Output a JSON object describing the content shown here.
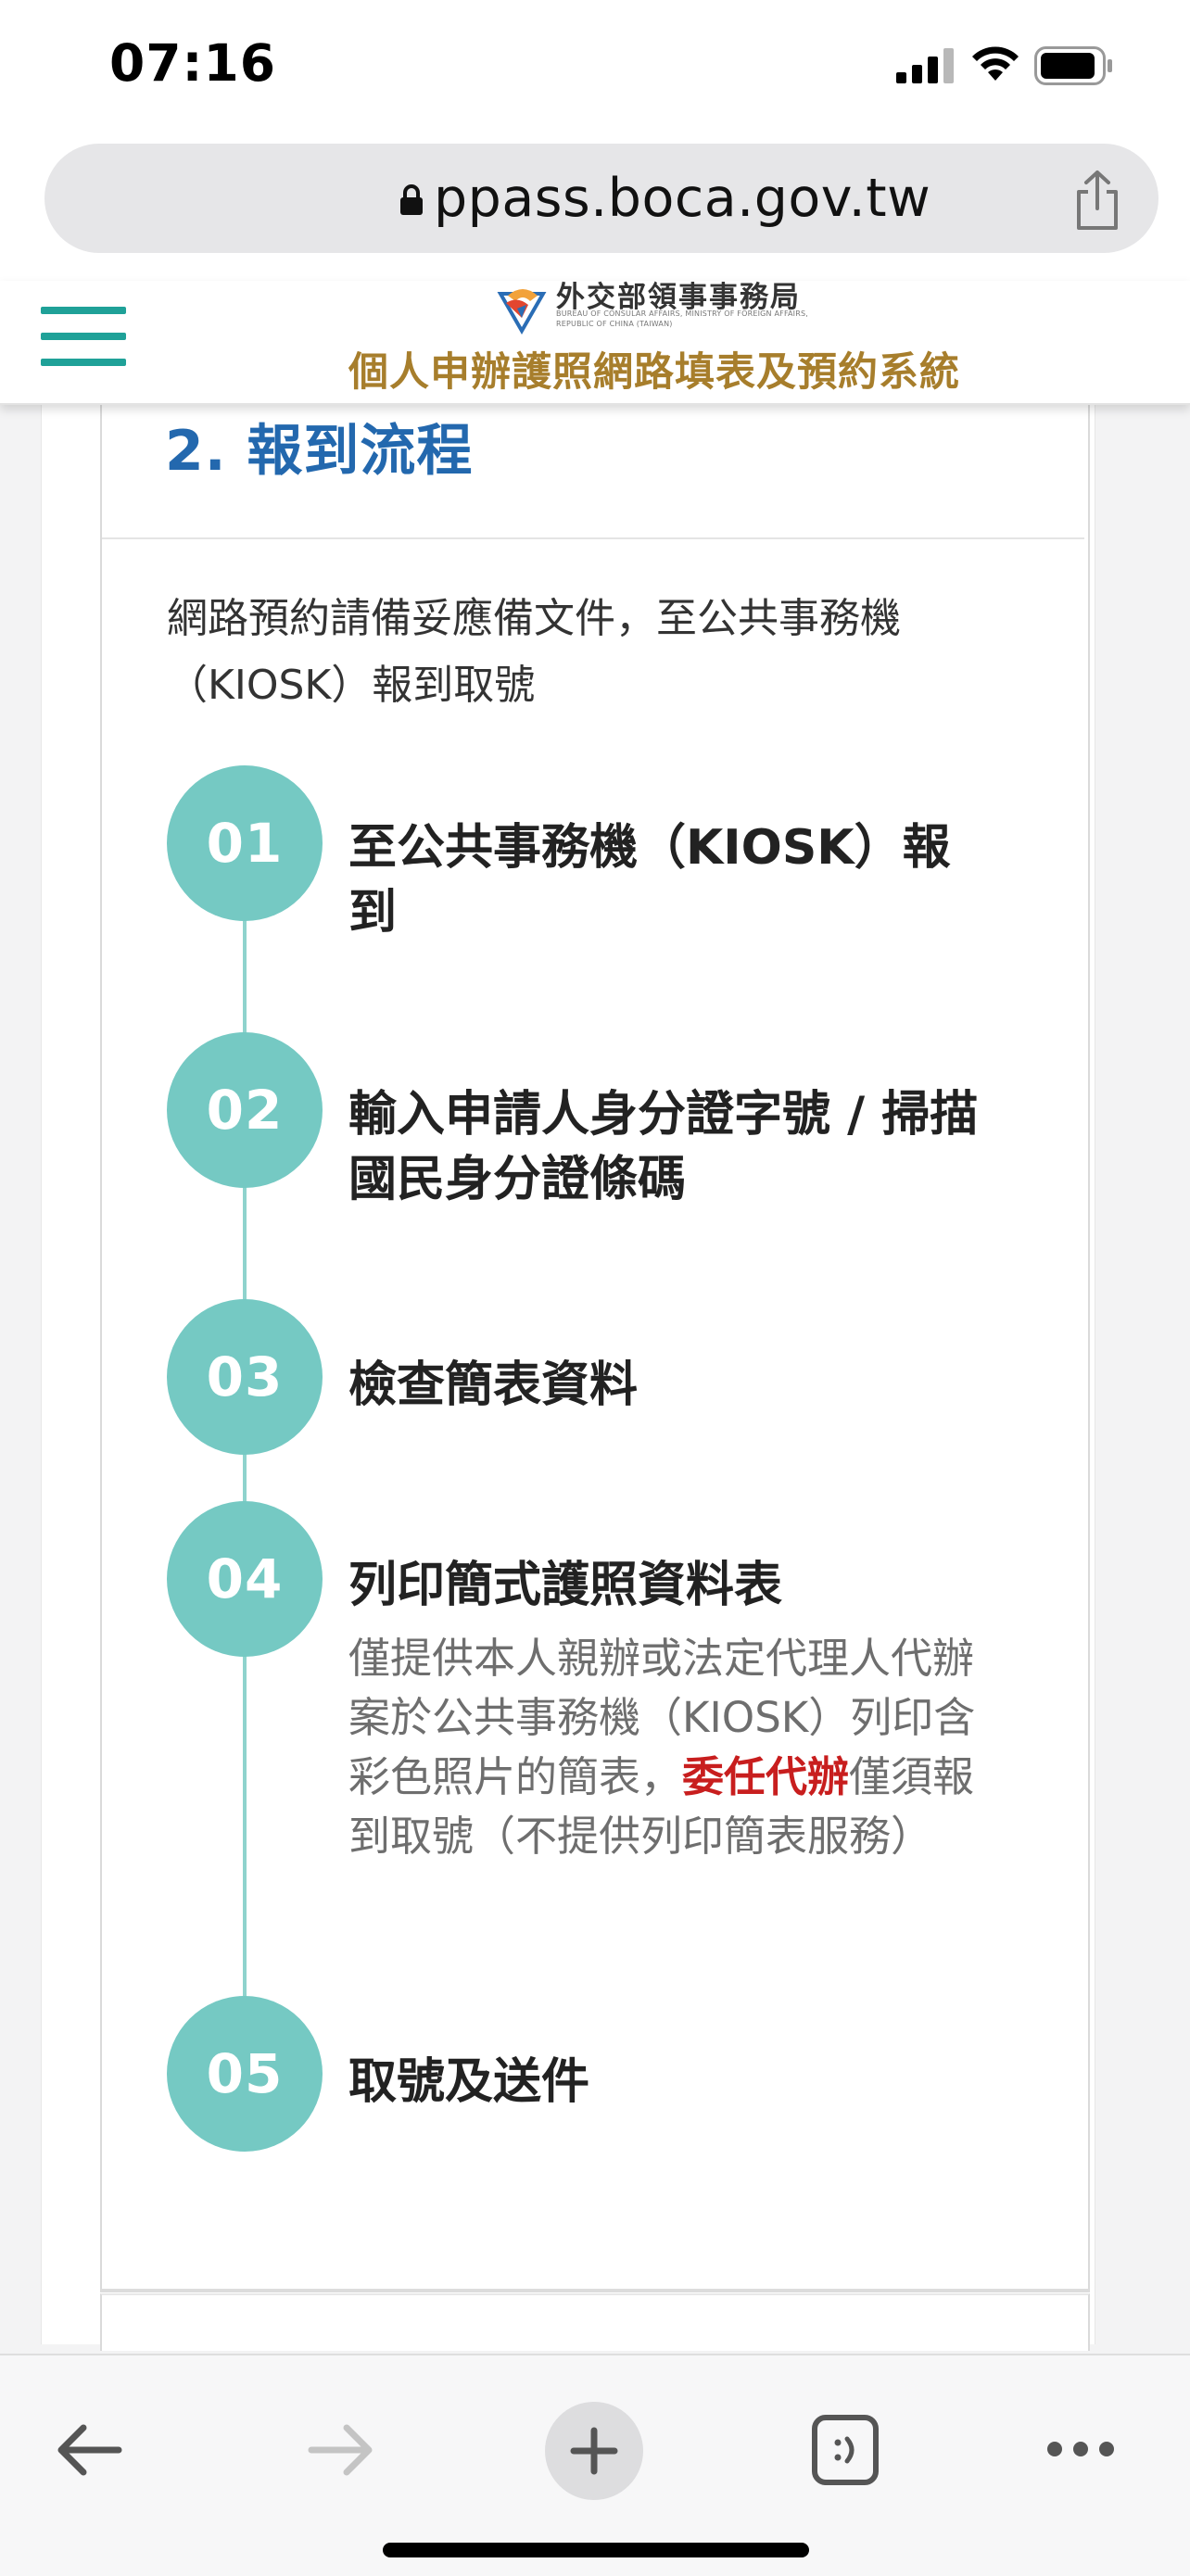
{
  "status_bar": {
    "time": "07:16"
  },
  "browser": {
    "url": "ppass.boca.gov.tw"
  },
  "site_header": {
    "agency_name_zh": "外交部領事事務局",
    "agency_name_en": "BUREAU OF CONSULAR AFFAIRS, MINISTRY OF FOREIGN AFFAIRS, REPUBLIC OF CHINA (TAIWAN)",
    "system_title": "個人申辦護照網路填表及預約系統"
  },
  "section": {
    "title": "2. 報到流程",
    "intro": "網路預約請備妥應備文件，至公共事務機（KIOSK）報到取號"
  },
  "steps": [
    {
      "number": "01",
      "title": "至公共事務機（KIOSK）報到"
    },
    {
      "number": "02",
      "title": "輸入申請人身分證字號 / 掃描國民身分證條碼"
    },
    {
      "number": "03",
      "title": "檢查簡表資料"
    },
    {
      "number": "04",
      "title": "列印簡式護照資料表",
      "desc_before": "僅提供本人親辦或法定代理人代辦案於公共事務機（KIOSK）列印含彩色照片的簡表，",
      "desc_highlight": "委任代辦",
      "desc_after": "僅須報到取號（不提供列印簡表服務）"
    },
    {
      "number": "05",
      "title": "取號及送件"
    }
  ],
  "colors": {
    "teal": "#75c9c3",
    "menu_teal": "#1fa198",
    "title_blue": "#2368ae",
    "gold": "#a77e2c",
    "highlight_red": "#c81e1e"
  },
  "icons": {
    "signal": "signal-icon",
    "wifi": "wifi-icon",
    "battery": "battery-icon",
    "lock": "lock-icon",
    "share": "share-icon",
    "menu": "hamburger-menu-icon",
    "back": "arrow-left-icon",
    "forward": "arrow-right-icon",
    "new_tab": "plus-icon",
    "tabs": "tabs-icon",
    "more": "ellipsis-icon"
  }
}
